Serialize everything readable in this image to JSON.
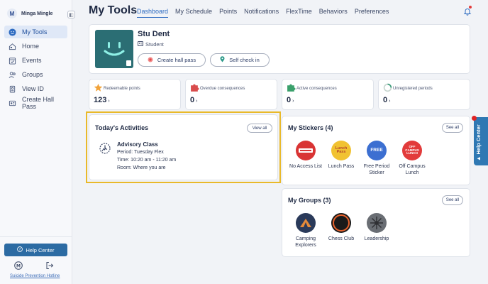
{
  "app": {
    "brand": "Minga Mingle",
    "logo_letter": "M"
  },
  "sidebar": {
    "items": [
      {
        "label": "My Tools",
        "icon": "face-icon",
        "active": true
      },
      {
        "label": "Home",
        "icon": "home-icon"
      },
      {
        "label": "Events",
        "icon": "calendar-check-icon"
      },
      {
        "label": "Groups",
        "icon": "people-icon"
      },
      {
        "label": "View ID",
        "icon": "id-badge-icon"
      },
      {
        "label": "Create Hall Pass",
        "icon": "pass-icon"
      }
    ],
    "help_label": "Help Center",
    "hotline": "Suicide Prevention Hotline"
  },
  "header": {
    "title": "My Tools",
    "tabs": [
      "Dashboard",
      "My Schedule",
      "Points",
      "Notifications",
      "FlexTime",
      "Behaviors",
      "Preferences"
    ],
    "active_tab": "Dashboard"
  },
  "profile": {
    "name": "Stu Dent",
    "role": "Student",
    "hall_pass_label": "Create hall pass",
    "self_check_label": "Self check in"
  },
  "stats": [
    {
      "label": "Redeemable points",
      "value": "123",
      "icon": "star-icon",
      "color": "#f2a33a"
    },
    {
      "label": "Overdue consequences",
      "value": "0",
      "icon": "puzzle-icon",
      "color": "#d94c4c"
    },
    {
      "label": "Active consequences",
      "value": "0",
      "icon": "puzzle-icon",
      "color": "#3aa06b"
    },
    {
      "label": "Unregistered periods",
      "value": "0",
      "icon": "progress-ring-icon",
      "color": "#3a9a78"
    }
  ],
  "activities": {
    "title": "Today's Activities",
    "view_all": "View all",
    "name": "Advisory Class",
    "period": "Period: Tuesday Flex",
    "time": "Time: 10:20 am - 11:20 am",
    "room": "Room: Where you are"
  },
  "stickers": {
    "title": "My Stickers (4)",
    "view_all": "See all",
    "items": [
      {
        "label": "No Access List",
        "badge": "NO ACCESS LIST",
        "color": "#d93434"
      },
      {
        "label": "Lunch Pass",
        "badge": "Lunch Pass",
        "color": "#f1c232"
      },
      {
        "label": "Free Period Sticker",
        "badge": "FREE",
        "color": "#3c6fd1"
      },
      {
        "label": "Off Campus Lunch",
        "badge": "OFF CAMPUS LUNCH",
        "color": "#e23b3b"
      }
    ]
  },
  "groups": {
    "title": "My Groups (3)",
    "view_all": "See all",
    "items": [
      {
        "label": "Camping Explorers",
        "color": "#2a3a5a"
      },
      {
        "label": "Chess Club",
        "color": "#1a1a1a"
      },
      {
        "label": "Leadership",
        "color": "#6a6e74"
      }
    ]
  },
  "help_tab": "Help Center",
  "colors": {
    "accent": "#2f6cc1",
    "highlight": "#e9b92a",
    "help": "#2f78b3"
  }
}
